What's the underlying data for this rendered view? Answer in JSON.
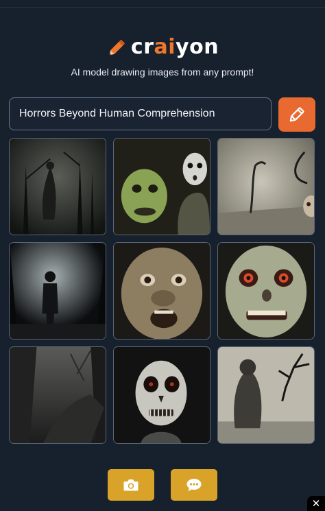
{
  "header": {
    "brand_prefix": "cr",
    "brand_accent": "ai",
    "brand_suffix": "yon",
    "tagline": "AI model drawing images from any prompt!"
  },
  "prompt": {
    "value": "Horrors Beyond Human Comprehension"
  },
  "colors": {
    "accent": "#e86a30",
    "footer_button": "#d9a228",
    "background": "#17202d"
  },
  "images": [
    {
      "subject": "dark forest figure"
    },
    {
      "subject": "green-faced children"
    },
    {
      "subject": "curved tendrils in fog"
    },
    {
      "subject": "shadow figure in forest"
    },
    {
      "subject": "wrinkled screaming face"
    },
    {
      "subject": "pale red-eyed face"
    },
    {
      "subject": "misty path"
    },
    {
      "subject": "skull face"
    },
    {
      "subject": "ghostly figure and cracks"
    }
  ],
  "footer": {
    "screenshot_icon": "camera-icon",
    "feedback_icon": "chat-bubble-icon",
    "close_glyph": "✕"
  }
}
